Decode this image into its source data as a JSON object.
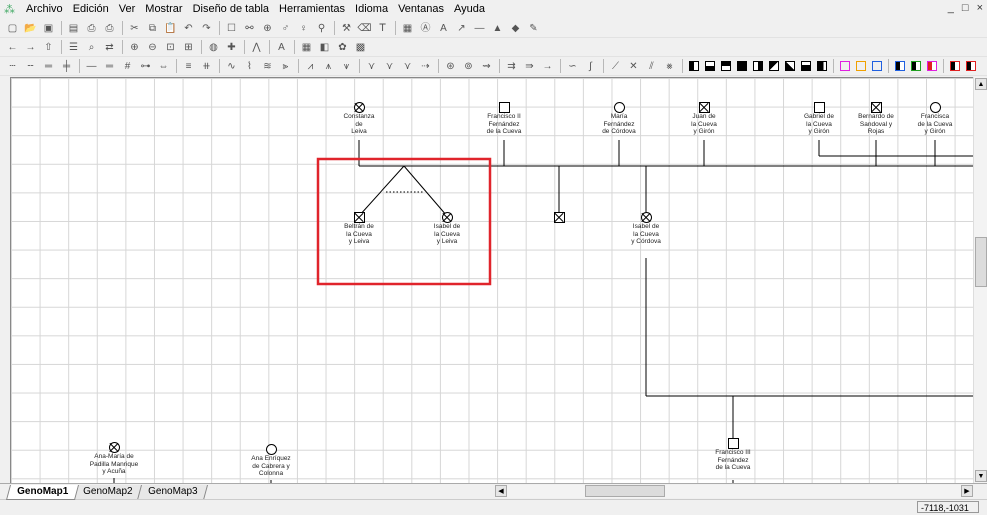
{
  "menu": {
    "items": [
      "Archivo",
      "Edición",
      "Ver",
      "Mostrar",
      "Diseño de tabla",
      "Herramientas",
      "Idioma",
      "Ventanas",
      "Ayuda"
    ],
    "window_controls": [
      "_",
      "□",
      "×"
    ]
  },
  "toolbar1_icons": [
    "new-icon",
    "open-icon",
    "save-icon",
    "sep",
    "layout-icon",
    "preview-icon",
    "print-icon",
    "sep",
    "cut-icon",
    "copy-icon",
    "paste-icon",
    "undo-icon",
    "redo-icon",
    "sep",
    "add-person-icon",
    "link-icon",
    "add-child-icon",
    "genogram-icon",
    "family-icon",
    "tree-icon",
    "sep",
    "tool-icon",
    "eraser-icon",
    "text-icon",
    "sep",
    "table-icon",
    "text-box-icon",
    "font-icon",
    "arrow-icon",
    "line-icon",
    "shape-icon",
    "fill-icon",
    "brush-icon"
  ],
  "toolbar2_icons": [
    "back-icon",
    "forward-icon",
    "up-icon",
    "sep",
    "list-icon",
    "find-icon",
    "replace-icon",
    "sep",
    "zoom-in-icon",
    "zoom-out-icon",
    "zoom-fit-icon",
    "zoom-page-icon",
    "sep",
    "globe-icon",
    "cross-icon",
    "sep",
    "twins-icon",
    "sep",
    "font-size-icon",
    "sep",
    "grid-icon",
    "color-icon",
    "palette-icon",
    "image-icon"
  ],
  "genogram": {
    "people": [
      {
        "id": "constanza",
        "name": "Constanza\nde\nLeiva",
        "sex": "female",
        "deceased": true
      },
      {
        "id": "francisco2",
        "name": "Francisco II\nFernández\nde la Cueva",
        "sex": "male",
        "deceased": false
      },
      {
        "id": "maria",
        "name": "María\nFernández\nde Córdova",
        "sex": "female",
        "deceased": false
      },
      {
        "id": "juan",
        "name": "Juan de\nla Cueva\ny Girón",
        "sex": "male",
        "deceased": true
      },
      {
        "id": "gabriel",
        "name": "Gabriel de\nla Cueva\ny Girón",
        "sex": "male",
        "deceased": false
      },
      {
        "id": "bernardo",
        "name": "Bernardo de\nSandoval y\nRojas",
        "sex": "male",
        "deceased": true
      },
      {
        "id": "francisca",
        "name": "Francisca\nde la Cueva\ny Girón",
        "sex": "female",
        "deceased": false
      },
      {
        "id": "beltran",
        "name": "Beltrán de\nla Cueva\ny Leiva",
        "sex": "male",
        "deceased": true
      },
      {
        "id": "isabel_leiva",
        "name": "Isabel de\nla Cueva\ny Leiva",
        "sex": "female",
        "deceased": true
      },
      {
        "id": "unknown_male",
        "name": "",
        "sex": "male",
        "deceased": true
      },
      {
        "id": "isabel_cordova",
        "name": "Isabel de\nla Cueva\ny Córdova",
        "sex": "female",
        "deceased": true
      },
      {
        "id": "ana_maria",
        "name": "Ana-María de\nPadilla Manrique\ny Acuña",
        "sex": "female",
        "deceased": true
      },
      {
        "id": "ana_enriquez",
        "name": "Ana Enríquez\nde Cabrera y\nColonna",
        "sex": "female",
        "deceased": false
      },
      {
        "id": "francisco3",
        "name": "Francisco III\nFernández\nde la Cueva",
        "sex": "male",
        "deceased": false
      }
    ]
  },
  "tabs": [
    "GenoMap1",
    "GenoMap2",
    "GenoMap3"
  ],
  "status": {
    "coordinates": "-7118,-1031"
  },
  "colors": {
    "highlight": "#e0242b"
  }
}
